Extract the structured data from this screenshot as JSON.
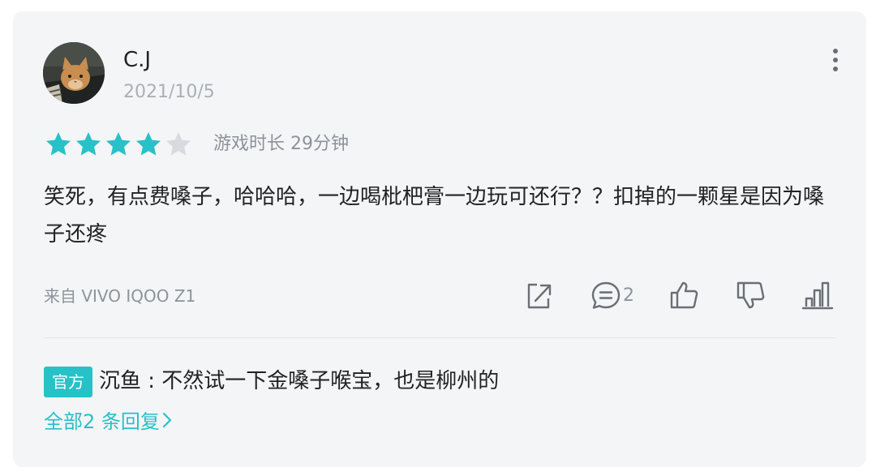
{
  "review": {
    "username": "C.J",
    "date": "2021/10/5",
    "rating": 4,
    "max_rating": 5,
    "playtime": "游戏时长 29分钟",
    "content": "笑死，有点费嗓子，哈哈哈，一边喝枇杷膏一边玩可还行？？扣掉的一颗星是因为嗓子还疼",
    "device": "来自 VIVO IQOO Z1",
    "comment_count": "2"
  },
  "official_reply": {
    "badge": "官方",
    "text": "沉鱼 : 不然试一下金嗓子喉宝，也是柳州的",
    "all_replies": "全部2 条回复"
  },
  "icons": {
    "more": "more-vertical-icon",
    "share": "share-icon",
    "comment": "comment-icon",
    "like": "thumbs-up-icon",
    "dislike": "thumbs-down-icon",
    "stats": "bar-chart-icon"
  },
  "colors": {
    "accent": "#26c2c8",
    "star_filled": "#26c2c8",
    "star_empty": "#d7dbdf",
    "card_bg": "#f4f5f7",
    "muted_text": "#8d939a"
  }
}
